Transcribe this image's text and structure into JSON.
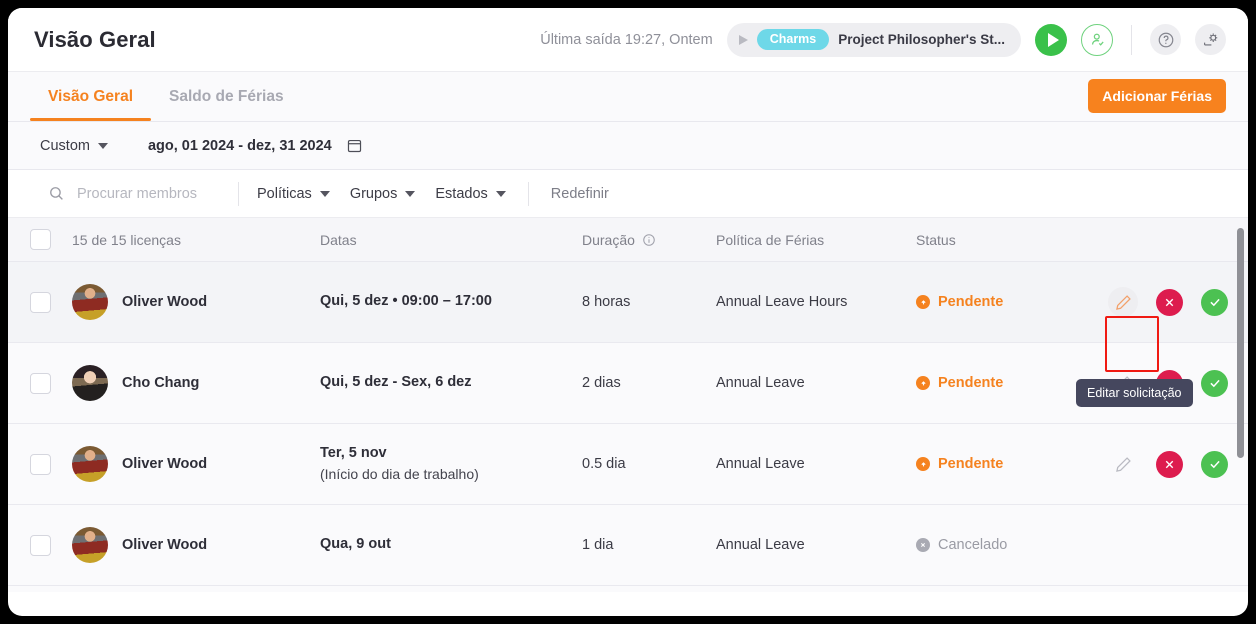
{
  "header": {
    "title": "Visão Geral",
    "last_exit": "Última saída 19:27, Ontem",
    "timer": {
      "chip": "Charms",
      "task": "Project Philosopher's St...",
      "play_icon": "play-icon",
      "start_icon": "play-button-icon",
      "user_icon": "user-check-icon",
      "help_icon": "help-circle-icon",
      "settings_icon": "settings-icon"
    }
  },
  "tabs": [
    {
      "label": "Visão Geral",
      "active": true
    },
    {
      "label": "Saldo de Férias",
      "active": false
    }
  ],
  "actions": {
    "add_vacation": "Adicionar Férias"
  },
  "daterange": {
    "preset": "Custom",
    "range": "ago, 01 2024 - dez, 31 2024",
    "calendar_icon": "calendar-icon"
  },
  "filters": {
    "search_placeholder": "Procurar membros",
    "search_value": "",
    "search_icon": "search-icon",
    "items": [
      "Políticas",
      "Grupos",
      "Estados"
    ],
    "reset": "Redefinir"
  },
  "table": {
    "columns": {
      "select": "",
      "name": "15 de 15 licenças",
      "dates": "Datas",
      "duration": "Duração",
      "duration_info_icon": "info-icon",
      "policy": "Política de Férias",
      "status": "Status"
    },
    "rows": [
      {
        "name": "Oliver Wood",
        "avatar": "oliver",
        "dates": "Qui, 5 dez • 09:00 – 17:00",
        "dates_sub": "",
        "duration": "8 horas",
        "policy": "Annual Leave Hours",
        "status": "Pendente",
        "status_kind": "pendente",
        "highlighted": true,
        "has_actions": true
      },
      {
        "name": "Cho Chang",
        "avatar": "cho",
        "dates": "Qui, 5 dez - Sex, 6 dez",
        "dates_sub": "",
        "duration": "2 dias",
        "policy": "Annual Leave",
        "status": "Pendente",
        "status_kind": "pendente",
        "highlighted": false,
        "has_actions": true
      },
      {
        "name": "Oliver Wood",
        "avatar": "oliver",
        "dates": "Ter, 5 nov",
        "dates_sub": "(Início do dia de trabalho)",
        "duration": "0.5 dia",
        "policy": "Annual Leave",
        "status": "Pendente",
        "status_kind": "pendente",
        "highlighted": false,
        "has_actions": true
      },
      {
        "name": "Oliver Wood",
        "avatar": "oliver",
        "dates": "Qua, 9 out",
        "dates_sub": "",
        "duration": "1 dia",
        "policy": "Annual Leave",
        "status": "Cancelado",
        "status_kind": "cancelado",
        "highlighted": false,
        "has_actions": false
      }
    ]
  },
  "tooltip": {
    "text": "Editar solicitação"
  },
  "colors": {
    "accent": "#f5821f",
    "approve": "#4cc152",
    "reject": "#dd1c4e",
    "chip": "#6ed8e8",
    "highlight_border": "#f01a13"
  }
}
